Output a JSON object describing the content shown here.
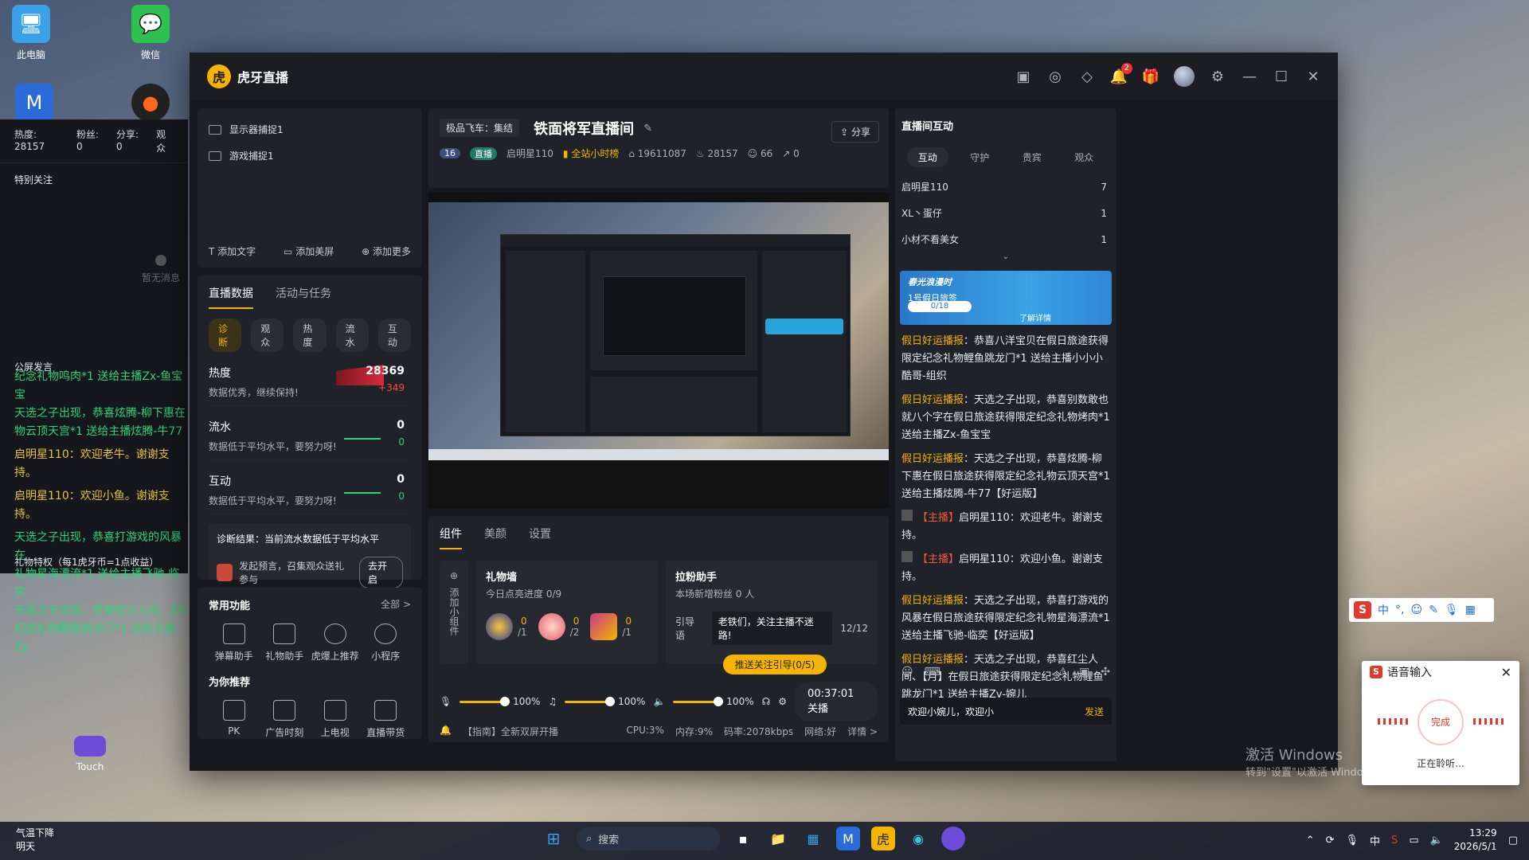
{
  "desktop": {
    "icons": [
      {
        "label": "此电脑",
        "icon": "computer-icon"
      },
      {
        "label": "微信",
        "icon": "wechat-icon"
      },
      {
        "label": "Touch",
        "icon": "touch-icon"
      }
    ]
  },
  "left_panel": {
    "stats": {
      "heat": "热度: 28157",
      "fans": "粉丝: 0",
      "share": "分享: 0",
      "watch": "观众"
    },
    "special": "特别关注",
    "empty": "暂无消息",
    "public": "公屏发言",
    "chat": [
      {
        "text": "纪念礼物鸣肉*1 送给主播Zx-鱼宝宝",
        "color": "green"
      },
      {
        "text": "天选之子出现，恭喜炫腾-柳下惠在",
        "color": "green"
      },
      {
        "text": "物云顶天宫*1 送给主播炫腾-牛77",
        "color": "green"
      },
      {
        "text": "启明星110：欢迎老牛。谢谢支持。",
        "color": "yellow"
      },
      {
        "text": "启明星110：欢迎小鱼。谢谢支持。",
        "color": "yellow"
      },
      {
        "text": "天选之子出现，恭喜打游戏的风暴在",
        "color": "green"
      },
      {
        "text": "礼物星海漂流*1 送给主播飞驰-临突",
        "color": "green"
      },
      {
        "text": "天选之子出现，恭喜红尘人间、【月",
        "color": "green"
      },
      {
        "text": "纪念礼物鲤鱼跳龙门*1 送给主播Zy",
        "color": "green"
      }
    ],
    "footer": "礼物特权（每1虎牙币=1点收益）"
  },
  "window": {
    "app_name": "虎牙直播",
    "notif_count": "2",
    "sources": [
      "显示器捕捉1",
      "游戏捕捉1"
    ],
    "source_actions": [
      "添加文字",
      "添加美屏",
      "添加更多"
    ],
    "data_tabs": [
      "直播数据",
      "活动与任务"
    ],
    "pills": [
      "诊断",
      "观众",
      "热度",
      "流水",
      "互动"
    ],
    "metrics": [
      {
        "name": "热度",
        "desc": "数据优秀，继续保持!",
        "value": "28369",
        "delta": "+349"
      },
      {
        "name": "流水",
        "desc": "数据低于平均水平，要努力呀!",
        "value": "0",
        "delta": "0"
      },
      {
        "name": "互动",
        "desc": "数据低于平均水平，要努力呀!",
        "value": "0",
        "delta": "0"
      }
    ],
    "diagnosis": {
      "title": "诊断结果：当前流水数据低于平均水平",
      "tip": "发起预言，召集观众送礼参与",
      "btn": "去开启"
    },
    "funcs_title": "常用功能",
    "funcs_all": "全部 >",
    "funcs": [
      "弹幕助手",
      "礼物助手",
      "虎爆上推荐",
      "小程序"
    ],
    "recommend_title": "为你推荐",
    "recommend": [
      "PK",
      "广告时刻",
      "上电视",
      "直播带货"
    ],
    "room": {
      "category": "极品飞车：集结",
      "title": "铁面将军直播间",
      "share": "分享",
      "level": "16",
      "badge": "直播",
      "host": "启明星110",
      "rank": "全站小时榜",
      "room_id": "19611087",
      "heat": "28157",
      "viewers": "66",
      "shares": "0"
    },
    "ctrl_tabs": [
      "组件",
      "美颜",
      "设置"
    ],
    "add_widget": "添加小组件",
    "gift_wall": {
      "title": "礼物墙",
      "sub": "今日点亮进度 0/9",
      "gifts": [
        {
          "n": "0",
          "d": "/1"
        },
        {
          "n": "0",
          "d": "/2"
        },
        {
          "n": "0",
          "d": "/1"
        }
      ]
    },
    "fans": {
      "title": "拉粉助手",
      "sub": "本场新增粉丝 0 人",
      "guide_label": "引导语",
      "guide_text": "老铁们，关注主播不迷路!",
      "guide_count": "12/12",
      "btn": "推送关注引导(0/5)"
    },
    "volumes": [
      "100%",
      "100%",
      "100%"
    ],
    "live_time": "00:37:01 关播",
    "status": {
      "tip": "【指南】全新双屏开播",
      "cpu": "CPU:3%",
      "mem": "内存:9%",
      "bitrate": "码率:2078kbps",
      "net": "网络:好",
      "detail": "详情 >"
    },
    "interact": {
      "title": "直播间互动",
      "tabs": [
        "互动",
        "守护",
        "贵宾",
        "观众"
      ],
      "viewers": [
        {
          "name": "启明星110",
          "n": "7"
        },
        {
          "name": "XL丶蛋仔",
          "n": "1"
        },
        {
          "name": "小材不看美女",
          "n": "1"
        }
      ],
      "banner": {
        "title": "春光浪漫时",
        "sub": "1号假日旅签",
        "progress": "0/18",
        "more": "了解详情"
      },
      "messages": [
        {
          "tag": "假日好运播报",
          "text": "：恭喜八洋宝贝在假日旅途获得限定纪念礼物鲤鱼跳龙门*1 送给主播小小小酷哥-组织"
        },
        {
          "tag": "假日好运播报",
          "text": "：天选之子出现，恭喜别数敢也就八个字在假日旅途获得限定纪念礼物烤肉*1 送给主播Zx-鱼宝宝"
        },
        {
          "tag": "假日好运播报",
          "text": "：天选之子出现，恭喜炫腾-柳下惠在假日旅途获得限定纪念礼物云顶天宫*1 送给主播炫腾-牛77【好运版】"
        },
        {
          "tag": "【主播】",
          "text": "启明星110：欢迎老牛。谢谢支持。"
        },
        {
          "tag": "【主播】",
          "text": "启明星110：欢迎小鱼。谢谢支持。"
        },
        {
          "tag": "假日好运播报",
          "text": "：天选之子出现，恭喜打游戏的风暴在假日旅途获得限定纪念礼物星海漂流*1 送给主播飞驰-临奕【好运版】"
        },
        {
          "tag": "假日好运播报",
          "text": "：天选之子出现，恭喜红尘人间、【月】在假日旅途获得限定纪念礼物鲤鱼跳龙门*1 送给主播Zy-婉儿"
        }
      ],
      "input": "欢迎小婉儿，欢迎小",
      "send": "发送"
    }
  },
  "voice": {
    "title": "语音输入",
    "btn": "完成",
    "status": "正在聆听..."
  },
  "watermark": {
    "line1": "激活 Windows",
    "line2": "转到\"设置\"以激活 Windows。"
  },
  "taskbar": {
    "weather_line1": "气温下降",
    "weather_line2": "明天",
    "search": "搜索",
    "time": "13:29",
    "date": "2026/5/1"
  }
}
